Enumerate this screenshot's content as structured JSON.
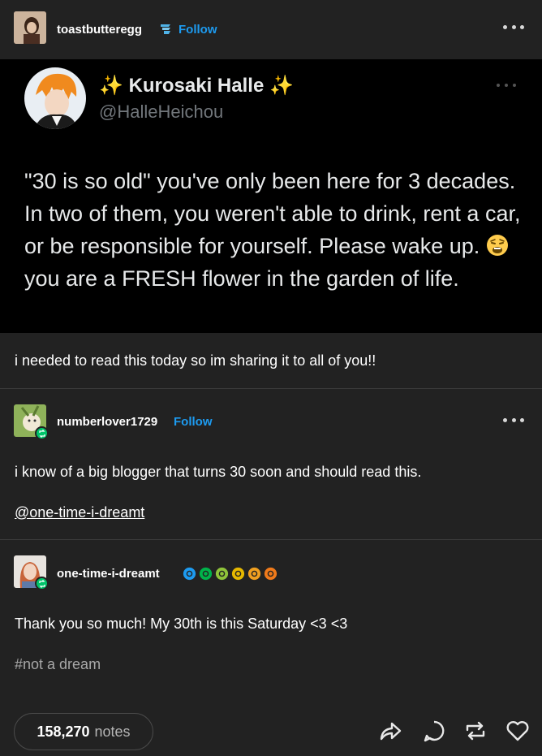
{
  "post": {
    "author": "toastbutteregg",
    "follow_label": "Follow",
    "tweet": {
      "name_prefix": "✨",
      "name": "Kurosaki Halle",
      "name_suffix": "✨",
      "handle": "@HalleHeichou",
      "text_part1": "\"30 is so old\" you've only been here for 3 decades. In two of them, you weren't able to drink, rent a car, or be responsible for yourself. Please wake up.",
      "text_part2": "you are a FRESH flower in the garden of life."
    },
    "caption": "i needed to read this today so im sharing it to all of you!!"
  },
  "reblog1": {
    "author": "numberlover1729",
    "follow_label": "Follow",
    "text": "i know of a big blogger that turns 30 soon and should read this.",
    "mention": "@one-time-i-dreamt"
  },
  "reblog2": {
    "author": "one-time-i-dreamt",
    "text": "Thank you so much! My 30th is this Saturday <3 <3",
    "tag": "#not a dream",
    "badge_colors": [
      "#1d9bf0",
      "#00b34a",
      "#8fc43a",
      "#e6b800",
      "#f0a020",
      "#f07a1a"
    ]
  },
  "footer": {
    "notes_count": "158,270",
    "notes_label": "notes"
  },
  "colors": {
    "background": "#222222",
    "accent": "#1d9bf0",
    "reblog_badge": "#00c46a"
  }
}
